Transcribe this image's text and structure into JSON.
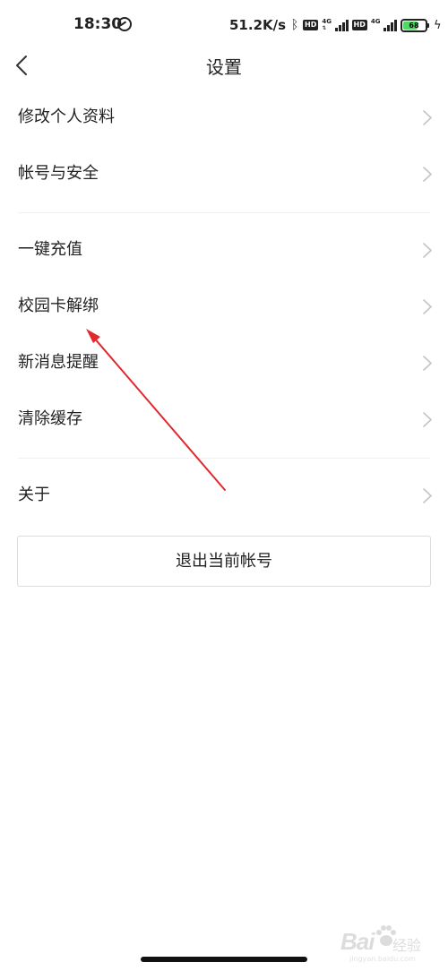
{
  "status_bar": {
    "time": "18:30",
    "net_speed": "51.2K/s",
    "hd_badge": "HD",
    "network_type": "4G",
    "battery_level": "68",
    "battery_fraction": 0.68,
    "battery_color": "#4cd964"
  },
  "nav": {
    "title": "设置",
    "back_icon": "chevron-left-icon"
  },
  "settings": {
    "group1": [
      {
        "label": "修改个人资料"
      },
      {
        "label": "帐号与安全"
      }
    ],
    "group2": [
      {
        "label": "一键充值"
      },
      {
        "label": "校园卡解绑"
      },
      {
        "label": "新消息提醒"
      },
      {
        "label": "清除缓存"
      }
    ],
    "group3": [
      {
        "label": "关于"
      }
    ]
  },
  "logout_label": "退出当前帐号",
  "annotation": {
    "type": "arrow",
    "color": "#e0282e",
    "points_to": "校园卡解绑"
  },
  "watermark": {
    "brand": "Bai",
    "sub": "经验",
    "url": "jingyan.baidu.com"
  }
}
